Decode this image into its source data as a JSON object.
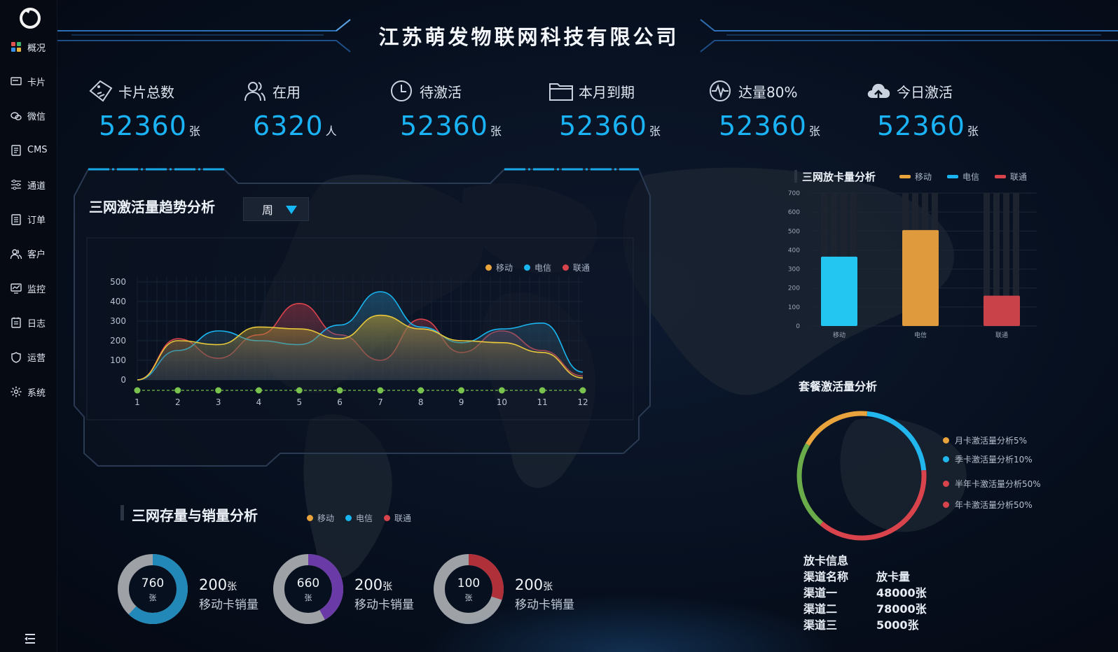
{
  "app": {
    "title": "江苏萌发物联网科技有限公司"
  },
  "sidebar": {
    "items": [
      {
        "label": "概况",
        "icon": "grid-icon"
      },
      {
        "label": "卡片",
        "icon": "card-icon"
      },
      {
        "label": "微信",
        "icon": "wechat-icon"
      },
      {
        "label": "CMS",
        "icon": "document-icon"
      },
      {
        "label": "通道",
        "icon": "sliders-icon"
      },
      {
        "label": "订单",
        "icon": "order-icon"
      },
      {
        "label": "客户",
        "icon": "users-icon"
      },
      {
        "label": "监控",
        "icon": "monitor-icon"
      },
      {
        "label": "日志",
        "icon": "log-icon"
      },
      {
        "label": "运营",
        "icon": "shield-icon"
      },
      {
        "label": "系统",
        "icon": "gear-icon"
      }
    ]
  },
  "stats": [
    {
      "label": "卡片总数",
      "value": "52360",
      "unit": "张",
      "icon": "card-tag-icon"
    },
    {
      "label": "在用",
      "value": "6320",
      "unit": "人",
      "icon": "users-icon"
    },
    {
      "label": "待激活",
      "value": "52360",
      "unit": "张",
      "icon": "clock-icon"
    },
    {
      "label": "本月到期",
      "value": "52360",
      "unit": "张",
      "icon": "folder-icon"
    },
    {
      "label": "达量80%",
      "value": "52360",
      "unit": "张",
      "icon": "pulse-icon"
    },
    {
      "label": "今日激活",
      "value": "52360",
      "unit": "张",
      "icon": "cloud-upload-icon"
    }
  ],
  "trend_panel": {
    "title": "三网激活量趋势分析",
    "select_value": "周"
  },
  "stock_panel": {
    "title": "三网存量与销量分析"
  },
  "bar_panel": {
    "title": "三网放卡量分析"
  },
  "pie_panel": {
    "title": "套餐激活量分析"
  },
  "legend": {
    "mobile": "移动",
    "telecom": "电信",
    "unicom": "联通"
  },
  "colors": {
    "mobile": "#e8a33c",
    "telecom": "#19b5f0",
    "unicom": "#d9434c",
    "accent": "#1ab3f5"
  },
  "donuts": [
    {
      "center": "760",
      "center_unit": "张",
      "value": "200",
      "unit": "张",
      "label": "移动卡销量",
      "ring_color": "#2288b8",
      "share": 0.62
    },
    {
      "center": "660",
      "center_unit": "张",
      "value": "200",
      "unit": "张",
      "label": "移动卡销量",
      "ring_color": "#6a3aa6",
      "share": 0.42
    },
    {
      "center": "100",
      "center_unit": "张",
      "value": "200",
      "unit": "张",
      "label": "移动卡销量",
      "ring_color": "#b0303a",
      "share": 0.3
    }
  ],
  "card_info": {
    "title": "放卡信息",
    "headers": [
      "渠道名称",
      "放卡量"
    ],
    "rows": [
      [
        "渠道一",
        "48000张"
      ],
      [
        "渠道二",
        "78000张"
      ],
      [
        "渠道三",
        "5000张"
      ]
    ]
  },
  "chart_data": [
    {
      "type": "area",
      "title": "三网激活量趋势分析",
      "x": [
        1,
        2,
        3,
        4,
        5,
        6,
        7,
        8,
        9,
        10,
        11,
        12
      ],
      "ylim": [
        0,
        500
      ],
      "yticks": [
        0,
        100,
        200,
        300,
        400,
        500
      ],
      "series": [
        {
          "name": "移动",
          "values": [
            0,
            200,
            180,
            270,
            260,
            210,
            330,
            260,
            200,
            190,
            140,
            10
          ]
        },
        {
          "name": "电信",
          "values": [
            0,
            150,
            250,
            200,
            180,
            280,
            450,
            270,
            190,
            260,
            290,
            40
          ]
        },
        {
          "name": "联通",
          "values": [
            0,
            210,
            110,
            230,
            390,
            230,
            100,
            310,
            140,
            250,
            150,
            20
          ]
        }
      ]
    },
    {
      "type": "bar",
      "title": "三网放卡量分析",
      "categories": [
        "移动",
        "电信",
        "联通"
      ],
      "values": [
        365,
        505,
        160
      ],
      "bar_colors": [
        "#22c6f0",
        "#e09a3e",
        "#c9424a"
      ],
      "ylim": [
        0,
        700
      ],
      "yticks": [
        0,
        100,
        200,
        300,
        400,
        500,
        600,
        700
      ]
    },
    {
      "type": "pie",
      "title": "套餐激活量分析",
      "slices": [
        {
          "label": "月卡激活量分析5%",
          "value": 5,
          "color": "#e8a33c"
        },
        {
          "label": "季卡激活量分析10%",
          "value": 10,
          "color": "#22b6ee"
        },
        {
          "label": "半年卡激活量分析50%",
          "value": 50,
          "color": "#d9434c"
        },
        {
          "label": "年卡激活量分析50%",
          "value": 50,
          "color": "#d9434c"
        }
      ]
    }
  ]
}
